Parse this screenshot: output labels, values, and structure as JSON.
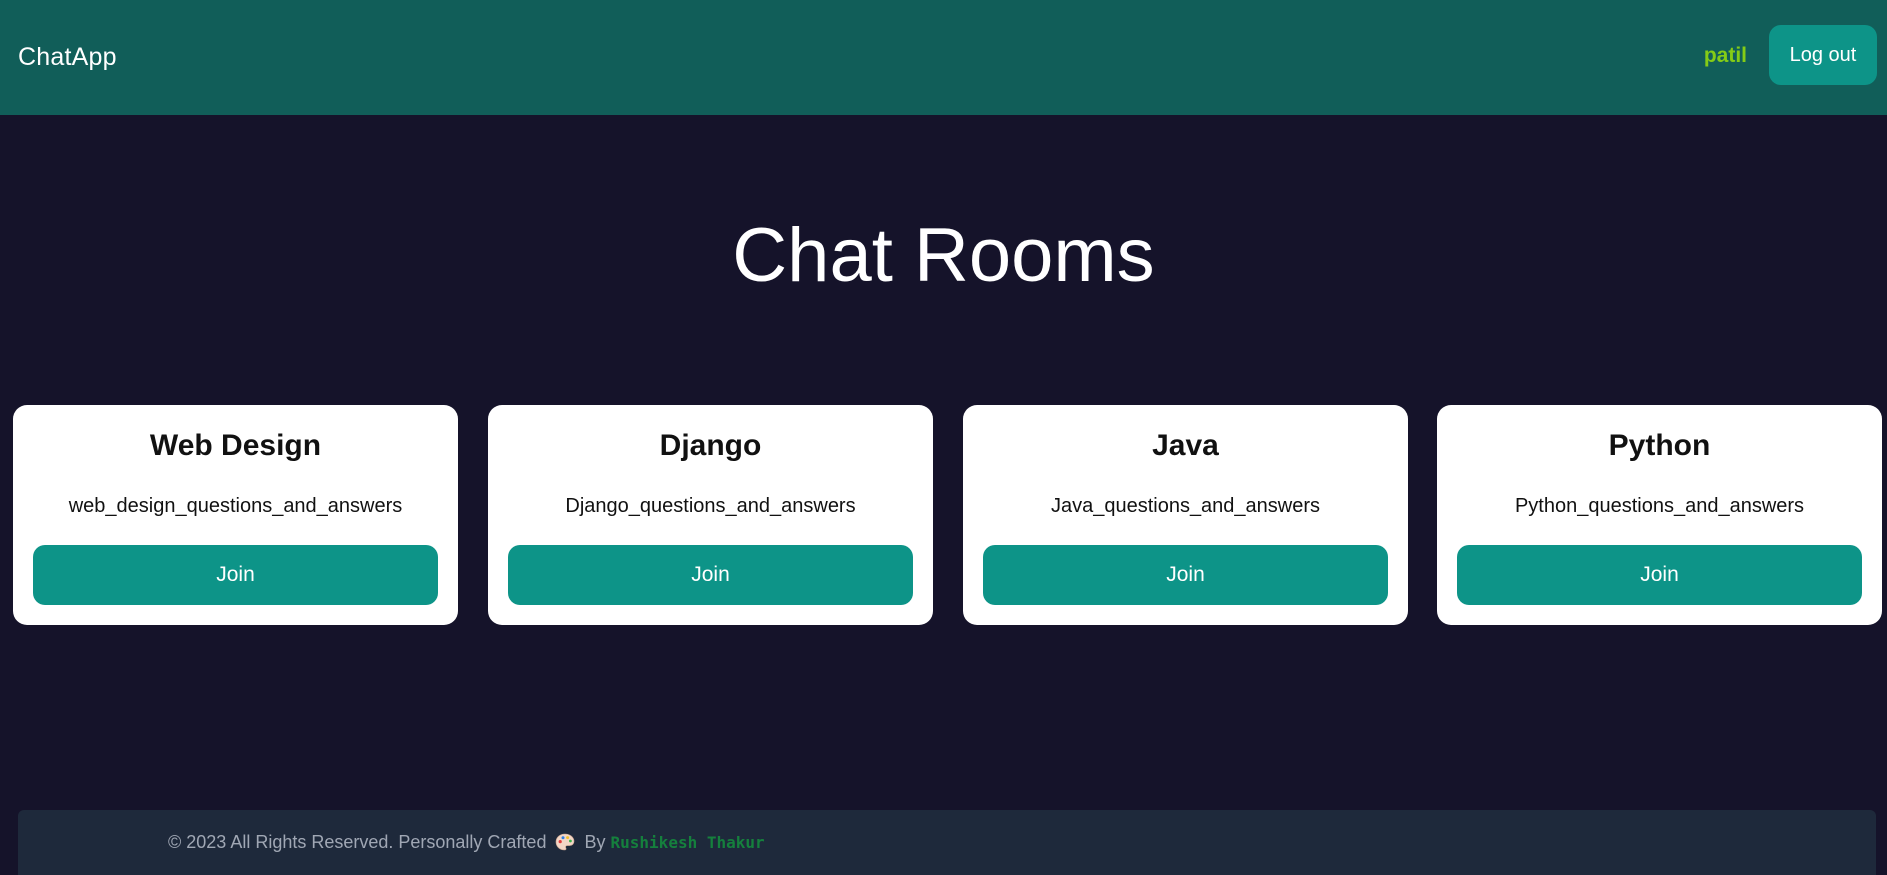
{
  "navbar": {
    "brand": "ChatApp",
    "username": "patil",
    "logout_label": "Log out"
  },
  "main": {
    "title": "Chat Rooms",
    "rooms": [
      {
        "name": "Web Design",
        "slug": "web_design_questions_and_answers",
        "join_label": "Join"
      },
      {
        "name": "Django",
        "slug": "Django_questions_and_answers",
        "join_label": "Join"
      },
      {
        "name": "Java",
        "slug": "Java_questions_and_answers",
        "join_label": "Join"
      },
      {
        "name": "Python",
        "slug": "Python_questions_and_answers",
        "join_label": "Join"
      }
    ]
  },
  "footer": {
    "text": "© 2023 All Rights Reserved. Personally Crafted",
    "icon": "palette-icon",
    "by": "By",
    "author": "Rushikesh Thakur"
  },
  "colors": {
    "navbar_bg": "#115e59",
    "page_bg": "#15132a",
    "accent": "#0d9488",
    "username": "#84cc16",
    "author": "#15803d",
    "footer_bg": "#1e293b"
  }
}
